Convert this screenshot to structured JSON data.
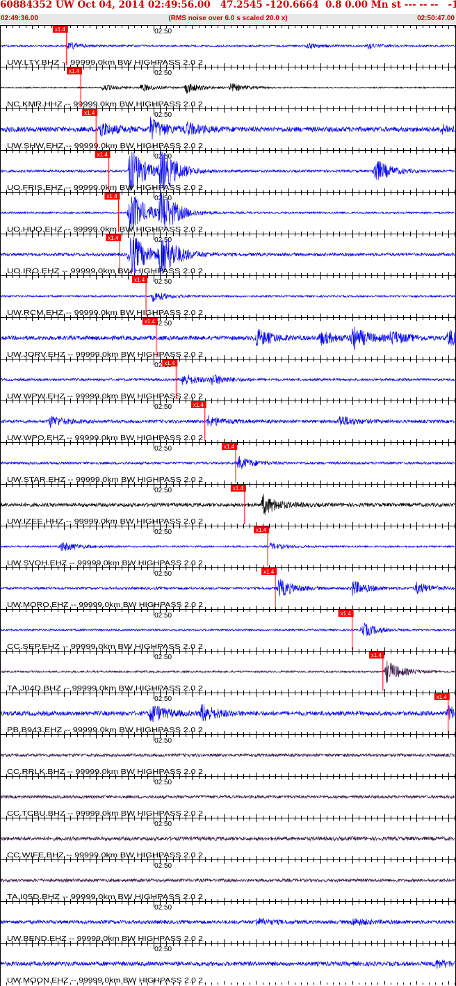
{
  "header": {
    "title": "60884352 UW Oct 04, 2014 02:49:56.00   47.2545 -120.6664  0.8 0.00 Mn st --- -- --   -1",
    "start_time": "02:49:36.00",
    "note": "(RMS noise over 6.0 s scaled 20.0 x)",
    "end_time": "02:50:47.00"
  },
  "colors": {
    "blue": "#0000ee",
    "black": "#000000",
    "purple": "#331144",
    "red": "#ff0000",
    "pick_text": "#ffffff"
  },
  "chart_data": {
    "type": "line",
    "title": "",
    "x_axis": {
      "start": "02:49:36.00",
      "end": "02:50:47.00",
      "tick_label": "02:50",
      "tick_interval_s": 1
    },
    "pick_label": "x1.4",
    "traces": [
      {
        "label": "UW.LTY.BHZ -- 99999.0km BW  HIGHPASS  2.0  2",
        "color": "blue",
        "pick_s": 10.4,
        "amplitude": 0.15,
        "events": [
          [
            10.5,
            0.6
          ],
          [
            48,
            0.35
          ],
          [
            57.5,
            0.4
          ]
        ]
      },
      {
        "label": "NC.KMR.HHZ -- 99999.0km BW  HIGHPASS  2.0  2",
        "color": "black",
        "pick_s": 12.6,
        "amplitude": 0.1,
        "events": [
          [
            16,
            0.5
          ],
          [
            22,
            0.6
          ],
          [
            29,
            0.9
          ],
          [
            36,
            0.7
          ]
        ]
      },
      {
        "label": "UW.SHW.EHZ -- 99999.0km BW  HIGHPASS  2.0  2",
        "color": "blue",
        "pick_s": 15.0,
        "amplitude": 0.4,
        "events": [
          [
            15.5,
            1.2
          ],
          [
            23.5,
            1.6
          ],
          [
            29,
            0.9
          ],
          [
            69,
            0.6
          ]
        ]
      },
      {
        "label": "UO.FRIS.EHZ -- 99999.0km BW  HIGHPASS  2.0  2",
        "color": "blue",
        "pick_s": 17.0,
        "amplitude": 0.2,
        "events": [
          [
            20.2,
            4.0
          ],
          [
            25,
            4.0
          ],
          [
            58.5,
            2.0
          ]
        ]
      },
      {
        "label": "UO.HUO.EHZ -- 99999.0km BW  HIGHPASS  2.0  2",
        "color": "blue",
        "pick_s": 18.5,
        "amplitude": 0.15,
        "events": [
          [
            20.2,
            4.0
          ],
          [
            25,
            4.0
          ]
        ]
      },
      {
        "label": "UO.IRO.EHZ -- 99999.0km BW  HIGHPASS  2.0  2",
        "color": "blue",
        "pick_s": 18.7,
        "amplitude": 0.25,
        "events": [
          [
            20.2,
            4.0
          ],
          [
            25,
            4.0
          ]
        ]
      },
      {
        "label": "UW.RCM.EHZ -- 99999.0km BW  HIGHPASS  2.0  2",
        "color": "blue",
        "pick_s": 22.8,
        "amplitude": 0.15,
        "events": [
          [
            23.8,
            0.8
          ]
        ]
      },
      {
        "label": "UW.JORV.EHZ -- 99999.0km BW  HIGHPASS  2.0  2",
        "color": "blue",
        "pick_s": 24.4,
        "amplitude": 0.35,
        "events": [
          [
            40,
            1.4
          ],
          [
            50,
            1.0
          ],
          [
            55,
            1.8
          ],
          [
            61,
            1.0
          ],
          [
            70,
            1.2
          ]
        ]
      },
      {
        "label": "UW.WPW.EHZ -- 99999.0km BW  HIGHPASS  2.0  2",
        "color": "blue",
        "pick_s": 27.5,
        "amplitude": 0.2,
        "events": [
          [
            28.5,
            1.0
          ],
          [
            33,
            0.8
          ]
        ]
      },
      {
        "label": "UW.WPO.EHZ -- 99999.0km BW  HIGHPASS  2.0  2",
        "color": "blue",
        "pick_s": 32.0,
        "amplitude": 0.25,
        "events": [
          [
            7.8,
            0.9
          ],
          [
            32.5,
            0.8
          ],
          [
            53,
            0.9
          ]
        ]
      },
      {
        "label": "UW.STAR.EHZ -- 99999.0km BW  HIGHPASS  2.0  2",
        "color": "blue",
        "pick_s": 36.8,
        "amplitude": 0.2,
        "events": [
          [
            37.2,
            1.0
          ]
        ]
      },
      {
        "label": "UW.IZEE.HHZ -- 99999.0km BW  HIGHPASS  2.0  2",
        "color": "black",
        "pick_s": 38.2,
        "amplitude": 0.3,
        "events": [
          [
            41,
            1.6
          ]
        ]
      },
      {
        "label": "UW.SVOH.EHZ -- 99999.0km BW  HIGHPASS  2.0  2",
        "color": "blue",
        "pick_s": 41.8,
        "amplitude": 0.15,
        "events": [
          [
            9.5,
            0.8
          ],
          [
            42.2,
            0.5
          ]
        ]
      },
      {
        "label": "UW.MORO.EHZ -- 99999.0km BW  HIGHPASS  2.0  2",
        "color": "blue",
        "pick_s": 43.0,
        "amplitude": 0.2,
        "events": [
          [
            43.5,
            1.5
          ],
          [
            55,
            1.2
          ],
          [
            65,
            0.9
          ]
        ]
      },
      {
        "label": "CC.SEP.EHZ -- 99999.0km BW  HIGHPASS  2.0  2",
        "color": "blue",
        "pick_s": 55.0,
        "amplitude": 0.15,
        "events": [
          [
            56.5,
            1.2
          ]
        ]
      },
      {
        "label": "TA.J04D.BHZ -- 99999.0km BW  HIGHPASS  2.0  2",
        "color": "purple",
        "pick_s": 59.8,
        "amplitude": 0.15,
        "events": [
          [
            60.3,
            1.8
          ]
        ]
      },
      {
        "label": "PB.B943.EHZ -- 99999.0km BW  HIGHPASS  2.0  2",
        "color": "blue",
        "pick_s": 70.0,
        "amplitude": 0.35,
        "events": [
          [
            23.5,
            1.6
          ],
          [
            31.5,
            1.4
          ],
          [
            70,
            1.0
          ]
        ]
      },
      {
        "label": "CC.RRLK.BHZ -- 99999.0km BW  HIGHPASS  2.0  2",
        "color": "purple",
        "pick_s": null,
        "amplitude": 0.25,
        "events": []
      },
      {
        "label": "CC.TCBU.BHZ -- 99999.0km BW  HIGHPASS  2.0  2",
        "color": "purple",
        "pick_s": null,
        "amplitude": 0.25,
        "events": []
      },
      {
        "label": "CC.WIFE.BHZ -- 99999.0km BW  HIGHPASS  2.0  2",
        "color": "purple",
        "pick_s": null,
        "amplitude": 0.3,
        "events": []
      },
      {
        "label": "TA.I05D.BHZ -- 99999.0km BW  HIGHPASS  2.0  2",
        "color": "purple",
        "pick_s": null,
        "amplitude": 0.25,
        "events": []
      },
      {
        "label": "UW.BEND.EHZ -- 99999.0km BW  HIGHPASS  2.0  2",
        "color": "blue",
        "pick_s": null,
        "amplitude": 0.3,
        "events": [
          [
            40,
            0.5
          ],
          [
            55,
            0.5
          ]
        ]
      },
      {
        "label": "UW.MOON.EHZ -- 99999.0km BW  HIGHPASS  2.0  2",
        "color": "blue",
        "pick_s": null,
        "amplitude": 0.35,
        "events": [
          [
            68,
            0.6
          ]
        ]
      }
    ]
  }
}
